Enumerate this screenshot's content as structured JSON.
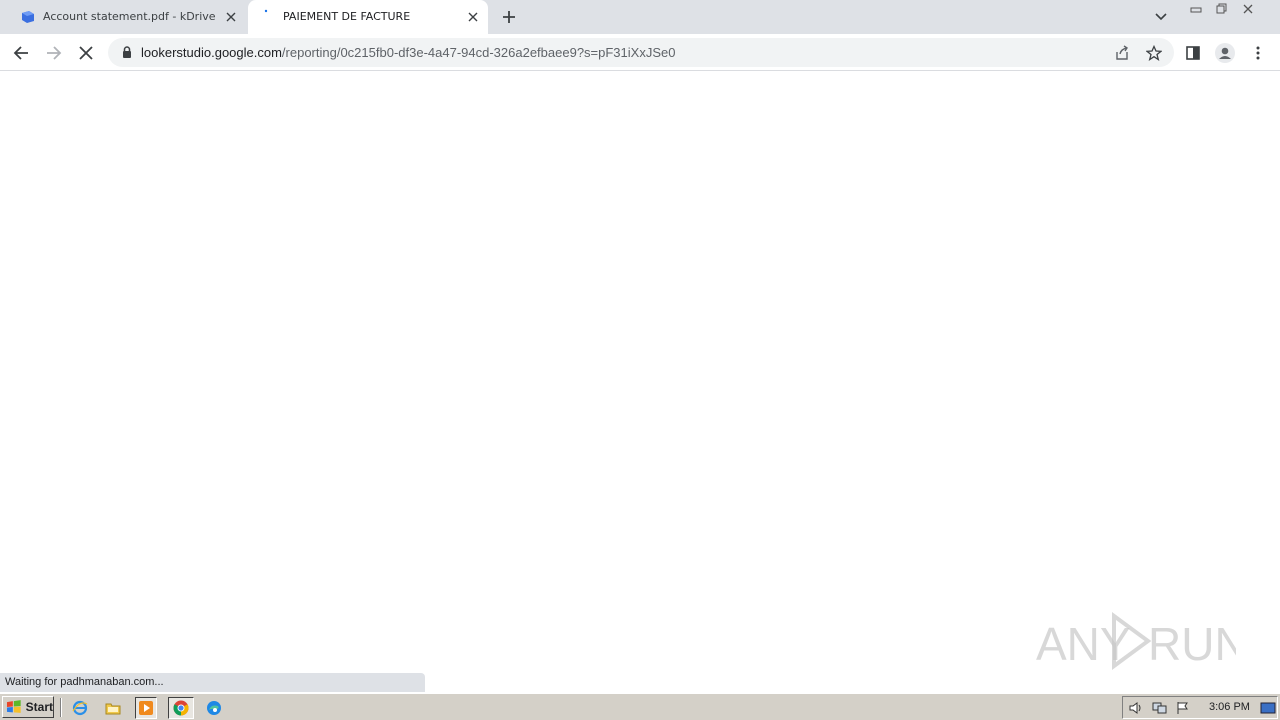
{
  "browser": {
    "tabs": [
      {
        "title": "Account statement.pdf - kDrive by Infomaniak",
        "favicon": "kdrive-icon",
        "active": false
      },
      {
        "title": "PAIEMENT DE FACTURE",
        "favicon": "loading-icon",
        "active": true
      }
    ],
    "url_host": "lookerstudio.google.com",
    "url_path": "/reporting/0c215fb0-df3e-4a47-94cd-326a2efbaee9?s=pF31iXxJSe0",
    "status_text": "Waiting for padhmanaban.com..."
  },
  "watermark": "ANY RUN",
  "taskbar": {
    "start_label": "Start",
    "clock": "3:06 PM",
    "quick_launch": [
      "ie-icon",
      "folder-icon",
      "media-player-icon",
      "chrome-icon",
      "edge-icon"
    ]
  },
  "colors": {
    "tabstrip": "#dee1e6",
    "omnibox": "#f1f3f4",
    "taskbar": "#d4d0c8"
  }
}
